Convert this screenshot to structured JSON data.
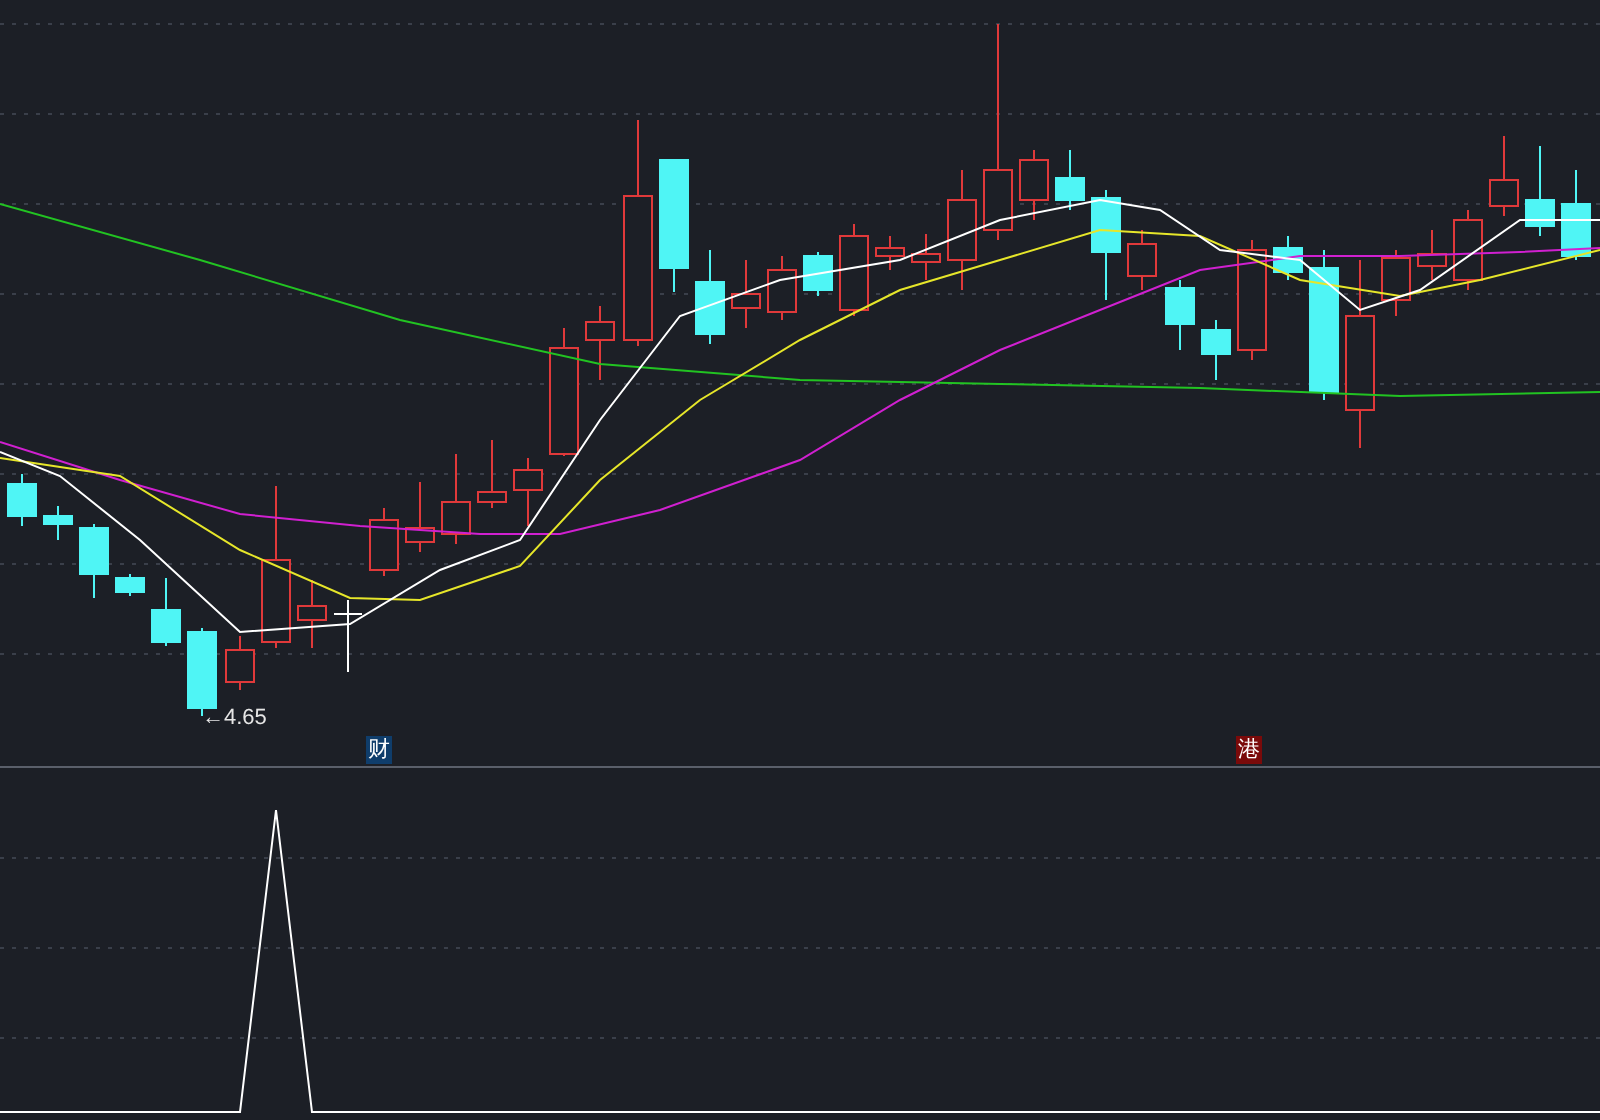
{
  "price_chart": {
    "low_label": "←4.65"
  },
  "event_markers": [
    {
      "label": "财",
      "color": "#0f3d6b"
    },
    {
      "label": "港",
      "color": "#7a0a0a"
    }
  ]
}
